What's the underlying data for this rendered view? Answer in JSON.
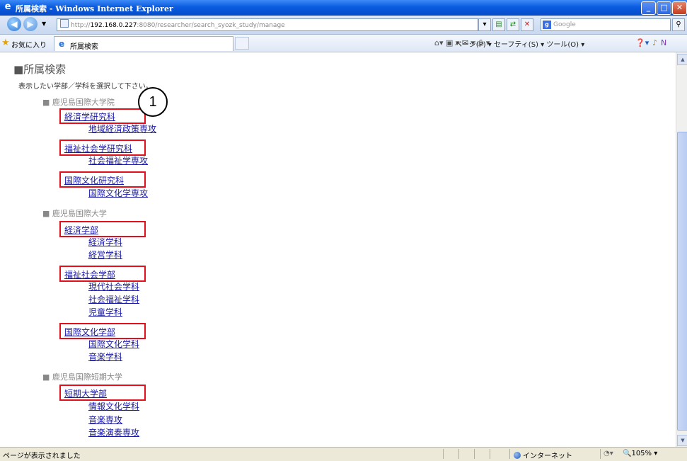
{
  "window": {
    "title": "所属検索 - Windows Internet Explorer"
  },
  "address": {
    "prefix": "http://",
    "host": "192.168.0.227",
    "rest": ":8080/researcher/search_syozk_study/manage"
  },
  "search": {
    "placeholder": "Google"
  },
  "favorites": {
    "label": "お気に入り",
    "tab_label": "所属検索"
  },
  "commandbar": {
    "text": "ページ(P) ▾  セーフティ(S) ▾  ツール(O) ▾"
  },
  "status": {
    "text": "ページが表示されました",
    "zone": "インターネット",
    "zoom": "105%"
  },
  "page": {
    "title": "■所属検索",
    "instruction": "表示したい学部／学科を選択して下さい。",
    "callout": "1",
    "universities": [
      {
        "name": "■ 鹿児島国際大学院",
        "faculties": [
          {
            "name": "経済学研究科",
            "subs": [
              "地域経済政策専攻"
            ]
          },
          {
            "name": "福祉社会学研究科",
            "subs": [
              "社会福祉学専攻"
            ]
          },
          {
            "name": "国際文化研究科",
            "subs": [
              "国際文化学専攻"
            ]
          }
        ]
      },
      {
        "name": "■ 鹿児島国際大学",
        "faculties": [
          {
            "name": "経済学部",
            "subs": [
              "経済学科",
              "経営学科"
            ]
          },
          {
            "name": "福祉社会学部",
            "subs": [
              "現代社会学科",
              "社会福祉学科",
              "児童学科"
            ]
          },
          {
            "name": "国際文化学部",
            "subs": [
              "国際文化学科",
              "音楽学科"
            ]
          }
        ]
      },
      {
        "name": "■ 鹿児島国際短期大学",
        "faculties": [
          {
            "name": "短期大学部",
            "subs": [
              "情報文化学科",
              "音楽専攻",
              "音楽演奏専攻"
            ]
          }
        ]
      }
    ]
  }
}
